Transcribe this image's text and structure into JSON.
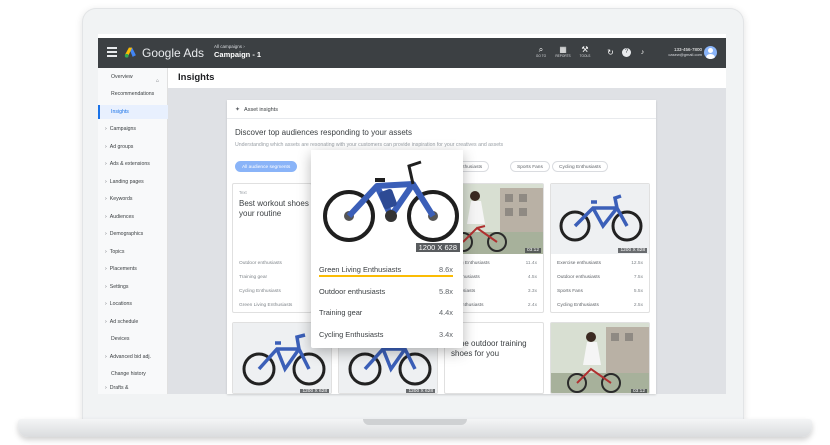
{
  "app": {
    "brand": "Google Ads",
    "campaign_label": "All campaigns ›",
    "campaign_name": "Campaign - 1",
    "tools": [
      {
        "icon": "search-icon",
        "label": "GO TO"
      },
      {
        "icon": "reports-icon",
        "label": "REPORTS"
      },
      {
        "icon": "tools-icon",
        "label": "TOOLS"
      }
    ],
    "account_phone": "133-456-7800",
    "account_email": "casew@gmail.com"
  },
  "sidebar": {
    "items": [
      {
        "label": "Overview",
        "type": "top"
      },
      {
        "label": "Recommendations",
        "type": "top"
      },
      {
        "label": "Insights",
        "type": "active"
      },
      {
        "label": "Campaigns",
        "type": "sub"
      },
      {
        "label": "Ad groups",
        "type": "sub"
      },
      {
        "label": "Ads & extensions",
        "type": "sub"
      },
      {
        "label": "Landing pages",
        "type": "sub"
      },
      {
        "label": "Keywords",
        "type": "sub"
      },
      {
        "label": "Audiences",
        "type": "sub"
      },
      {
        "label": "Demographics",
        "type": "sub"
      },
      {
        "label": "Topics",
        "type": "sub"
      },
      {
        "label": "Placements",
        "type": "sub"
      },
      {
        "label": "Settings",
        "type": "sub"
      },
      {
        "label": "Locations",
        "type": "sub"
      },
      {
        "label": "Ad schedule",
        "type": "sub"
      },
      {
        "label": "Devices",
        "type": "top"
      },
      {
        "label": "Advanced bid adj.",
        "type": "sub"
      },
      {
        "label": "Change history",
        "type": "top"
      },
      {
        "label": "Drafts &",
        "type": "sub"
      }
    ]
  },
  "page": {
    "title": "Insights",
    "panel_title": "Asset insights",
    "discover_title": "Discover top audiences responding to your assets",
    "discover_subtitle": "Understanding which assets are resonating with your customers can provide inspiration for your creatives and assets"
  },
  "chips": [
    {
      "label": "All audience segments",
      "selected": true
    },
    {
      "label": "Green Living Enthusiasts",
      "selected": false
    },
    {
      "label": "Sports Fans",
      "selected": false
    },
    {
      "label": "Cycling Enthusiasts",
      "selected": false
    }
  ],
  "chip_visible": [
    "All audience segments",
    "se Enthusiasts",
    "Sports Fans",
    "Cycling Enthusiasts"
  ],
  "text_card": {
    "kind": "Text",
    "text": "Best workout shoes for your routine",
    "rows": [
      {
        "label": "Outdoor enthusiasts",
        "value": ""
      },
      {
        "label": "Training gear",
        "value": ""
      },
      {
        "label": "Cycling Enthusiasts",
        "value": ""
      },
      {
        "label": "Green Living Enthusiasts",
        "value": ""
      }
    ]
  },
  "cyclist_card": {
    "badge": "03:12",
    "rows": [
      {
        "label": "Living Enthusiasts",
        "value": "11.4x"
      },
      {
        "label": "g Enthusiasts",
        "value": "4.5x"
      },
      {
        "label": "enthusiasts",
        "value": "3.3x"
      },
      {
        "label": "ree enthusiasts",
        "value": "2.4x"
      }
    ]
  },
  "bike_card": {
    "badge": "1200 X 628",
    "rows": [
      {
        "label": "Exercise enthusiasts",
        "value": "12.5x"
      },
      {
        "label": "Outdoor enthusiasts",
        "value": "7.5x"
      },
      {
        "label": "Sports Fans",
        "value": "5.5x"
      },
      {
        "label": "Cycling Enthusiasts",
        "value": "2.5x"
      }
    ]
  },
  "bottom_cards": [
    {
      "badge": "1200 X 628"
    },
    {
      "badge": "1200 X 628"
    },
    {
      "text": "d the outdoor training shoes for you"
    },
    {
      "badge": "03:12"
    }
  ],
  "popup": {
    "badge": "1200 X 628",
    "rows": [
      {
        "label": "Green Living Enthusiasts",
        "value": "8.6x"
      },
      {
        "label": "Outdoor enthusiasts",
        "value": "5.8x"
      },
      {
        "label": "Training gear",
        "value": "4.4x"
      },
      {
        "label": "Cycling Enthusiasts",
        "value": "3.4x"
      }
    ]
  },
  "colors": {
    "topbar": "#3c4043",
    "accent": "#1a73e8",
    "chip_selected": "#8ab4f8",
    "highlight": "#fbbc04",
    "bike": "#3b5fb8"
  }
}
